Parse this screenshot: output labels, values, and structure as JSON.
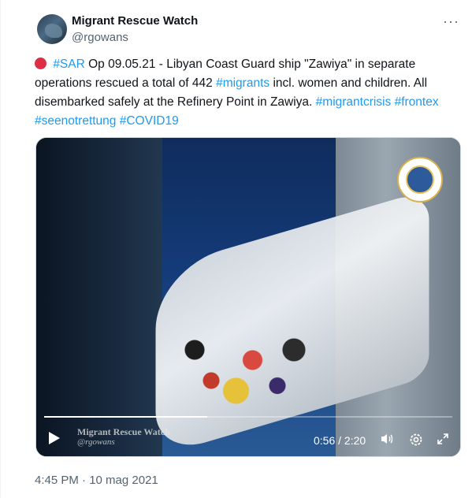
{
  "author": {
    "name": "Migrant Rescue Watch",
    "handle": "@rgowans"
  },
  "more_label": "···",
  "tweet": {
    "parts": [
      {
        "type": "text",
        "text": " "
      },
      {
        "type": "tag",
        "text": "#SAR"
      },
      {
        "type": "text",
        "text": " Op 09.05.21 - Libyan Coast Guard ship \"Zawiya\" in separate operations rescued a total of 442 "
      },
      {
        "type": "tag",
        "text": "#migrants"
      },
      {
        "type": "text",
        "text": " incl. women and children. All disembarked safely at the Refinery Point in Zawiya. "
      },
      {
        "type": "tag",
        "text": "#migrantcrisis"
      },
      {
        "type": "text",
        "text": " "
      },
      {
        "type": "tag",
        "text": "#frontex"
      },
      {
        "type": "text",
        "text": " "
      },
      {
        "type": "tag",
        "text": "#seenotrettung"
      },
      {
        "type": "text",
        "text": " "
      },
      {
        "type": "tag",
        "text": "#COVID19"
      }
    ]
  },
  "video": {
    "time_display": "0:56 / 2:20",
    "progress": 0.4,
    "watermark_title": "Migrant Rescue Watch",
    "watermark_handle": "@rgowans"
  },
  "footer": {
    "timestamp": "4:45 PM · 10 mag 2021"
  },
  "colors": {
    "link": "#1d9bf0",
    "text": "#0f1419",
    "secondary": "#536471"
  }
}
